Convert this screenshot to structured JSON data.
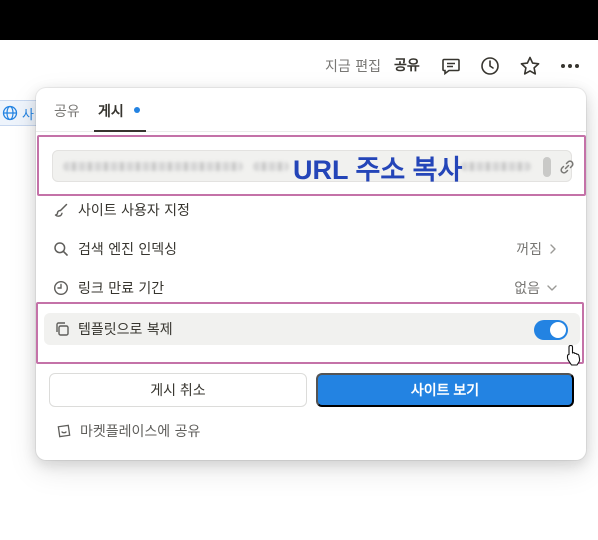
{
  "header": {
    "edited": "지금 편집",
    "share": "공유",
    "icons": [
      "comment-icon",
      "clock-history-icon",
      "star-icon",
      "more-horizontal-icon"
    ]
  },
  "side_chip": {
    "label": "사"
  },
  "popup": {
    "tabs": [
      {
        "label": "공유",
        "active": false
      },
      {
        "label": "게시",
        "active": true,
        "dot_color": "#2383e2"
      }
    ],
    "url": {
      "overlay_label": "URL 주소 복사"
    },
    "rows": {
      "customize": {
        "label": "사이트 사용자 지정"
      },
      "indexing": {
        "label": "검색 엔진 인덱싱",
        "value": "꺼짐"
      },
      "expiry": {
        "label": "링크 만료 기간",
        "value": "없음"
      },
      "template": {
        "label": "템플릿으로 복제",
        "toggle_on": true
      }
    },
    "buttons": {
      "unpublish": "게시 취소",
      "view_site": "사이트 보기"
    },
    "marketplace": "마켓플레이스에 공유"
  },
  "colors": {
    "accent": "#2383e2",
    "highlight": "#c472a8",
    "overlay_text": "#2445b8"
  }
}
